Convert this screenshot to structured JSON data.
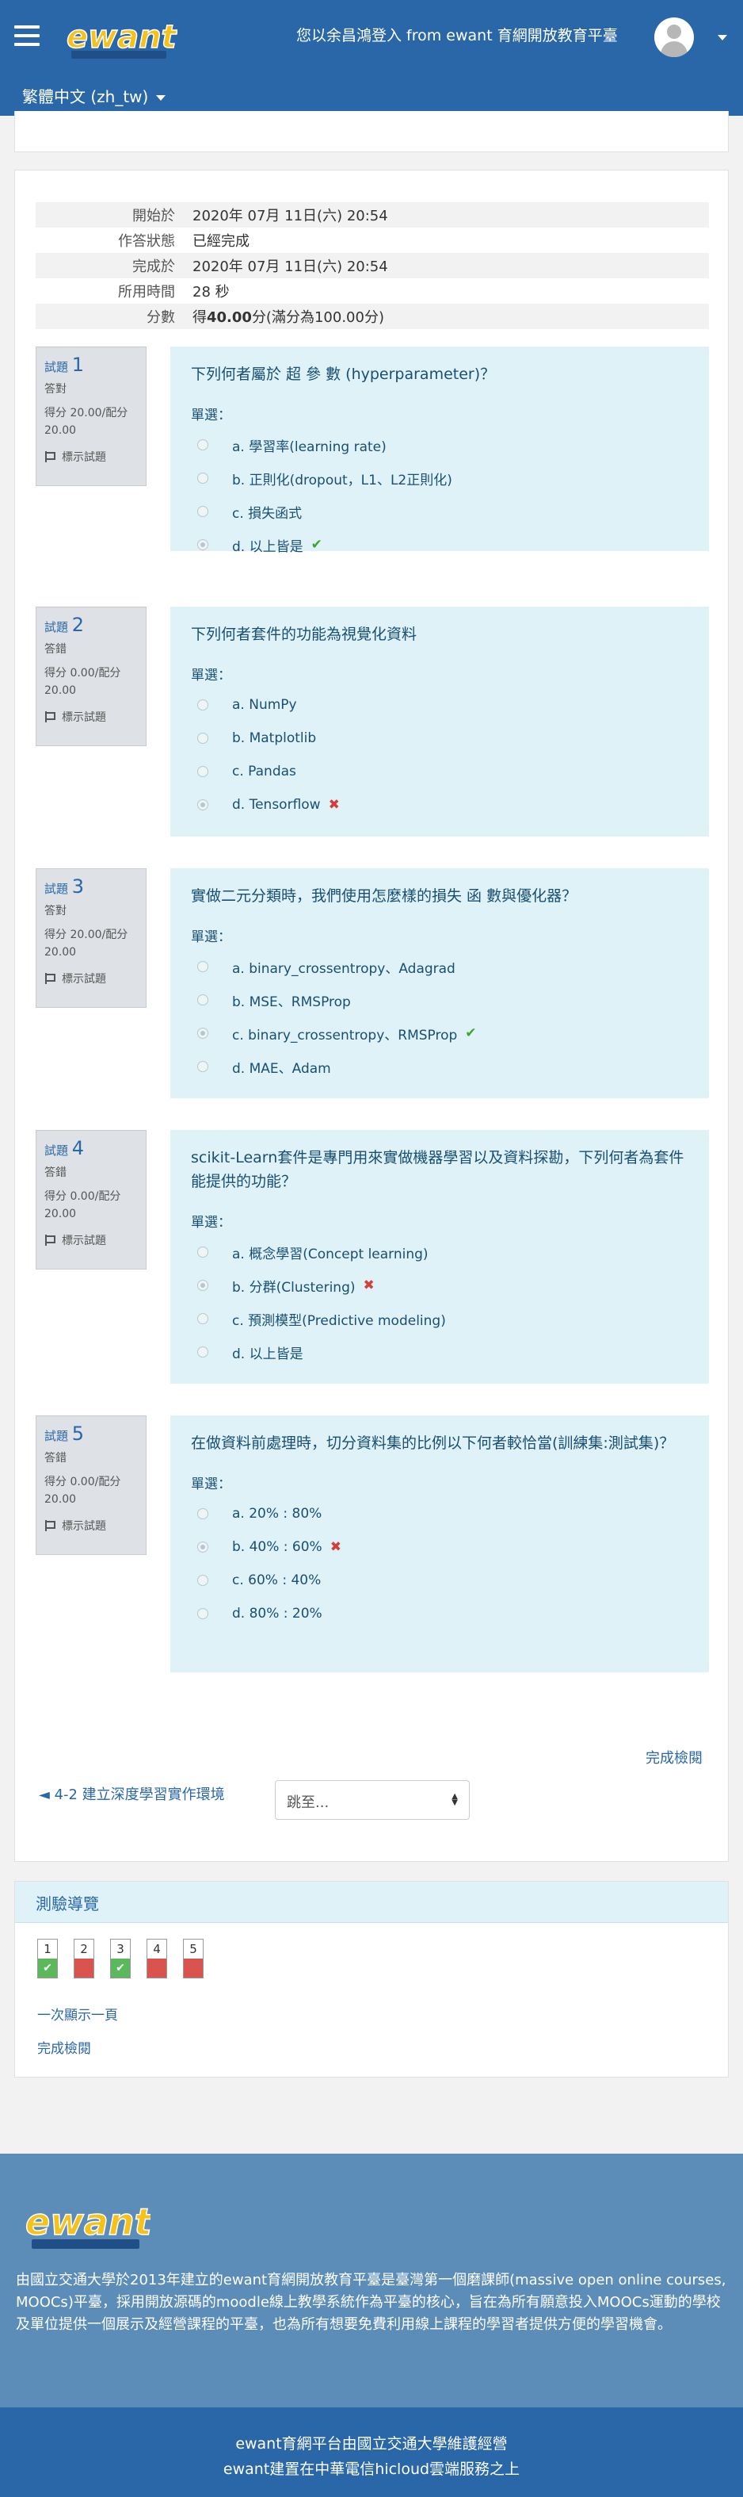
{
  "header": {
    "login_text": "您以余昌鴻登入  from ewant 育網開放教育平臺",
    "language": "繁體中文 (zh_tw)"
  },
  "summary": [
    {
      "label": "開始於",
      "value": "2020年 07月 11日(六) 20:54"
    },
    {
      "label": "作答狀態",
      "value": "已經完成"
    },
    {
      "label": "完成於",
      "value": "2020年 07月 11日(六) 20:54"
    },
    {
      "label": "所用時間",
      "value": "28 秒"
    },
    {
      "label": "分數",
      "value_pre": "得",
      "value_bold": "40.00",
      "value_post": "分(滿分為100.00分)"
    }
  ],
  "questions": [
    {
      "label": "試題",
      "number": "1",
      "state": "答對",
      "grade": "得分 20.00/配分 20.00",
      "flag": "標示試題",
      "text": "下列何者屬於 超 參 數 (hyperparameter)？",
      "prompt": "單選：",
      "options": [
        "a.  學習率(learning rate)",
        "b.  正則化(dropout，L1、L2正則化)",
        "c.  損失函式",
        "d.  以上皆是"
      ]
    },
    {
      "label": "試題",
      "number": "2",
      "state": "答錯",
      "grade": "得分 0.00/配分 20.00",
      "flag": "標示試題",
      "text": "下列何者套件的功能為視覺化資料",
      "prompt": "單選：",
      "options": [
        "a.  NumPy",
        "b.  Matplotlib",
        "c.  Pandas",
        "d.  Tensorflow"
      ]
    },
    {
      "label": "試題",
      "number": "3",
      "state": "答對",
      "grade": "得分 20.00/配分 20.00",
      "flag": "標示試題",
      "text": "實做二元分類時，我們使用怎麼樣的損失 函 數與優化器？",
      "prompt": "單選：",
      "options": [
        "a.  binary_crossentropy、Adagrad",
        "b.  MSE、RMSProp",
        "c.  binary_crossentropy、RMSProp",
        "d.  MAE、Adam"
      ]
    },
    {
      "label": "試題",
      "number": "4",
      "state": "答錯",
      "grade": "得分 0.00/配分 20.00",
      "flag": "標示試題",
      "text": "scikit-Learn套件是專門用來實做機器學習以及資料探勘，下列何者為套件能提供的功能？",
      "prompt": "單選：",
      "options": [
        "a.  概念學習(Concept learning)",
        "b.  分群(Clustering)",
        "c.  預測模型(Predictive modeling)",
        "d.  以上皆是"
      ]
    },
    {
      "label": "試題",
      "number": "5",
      "state": "答錯",
      "grade": "得分 0.00/配分 20.00",
      "flag": "標示試題",
      "text": "在做資料前處理時，切分資料集的比例以下何者較恰當(訓練集:測試集)？",
      "prompt": "單選：",
      "options": [
        "a.  20% : 80%",
        "b.  40% : 60%",
        "c.  60% : 40%",
        "d.  80% : 20%"
      ]
    }
  ],
  "finish_review": "完成檢閱",
  "prev_activity": "◄ 4-2 建立深度學習實作環境",
  "jump_to": "跳至...",
  "quiz_nav": {
    "title": "測驗導覽",
    "buttons": [
      {
        "num": "1",
        "result": "correct"
      },
      {
        "num": "2",
        "result": "incorrect"
      },
      {
        "num": "3",
        "result": "correct"
      },
      {
        "num": "4",
        "result": "incorrect"
      },
      {
        "num": "5",
        "result": "incorrect"
      }
    ],
    "show_one_page": "一次顯示一頁",
    "finish_review": "完成檢閱"
  },
  "footer": {
    "description": "由國立交通大學於2013年建立的ewant育網開放教育平臺是臺灣第一個磨課師(massive open online courses, MOOCs)平臺，採用開放源碼的moodle線上教學系統作為平臺的核心，旨在為所有願意投入MOOCs運動的學校及單位提供一個展示及經營課程的平臺，也為所有想要免費利用線上課程的學習者提供方便的學習機會。",
    "line1": "ewant育網平台由國立交通大學維護經營",
    "line2": "ewant建置在中華電信hicloud雲端服務之上"
  },
  "colors": {
    "brand": "#2a67a8",
    "footer": "#5b8db8",
    "question_bg": "#def2f8",
    "correct": "#5cb85c",
    "incorrect": "#d9534f"
  }
}
